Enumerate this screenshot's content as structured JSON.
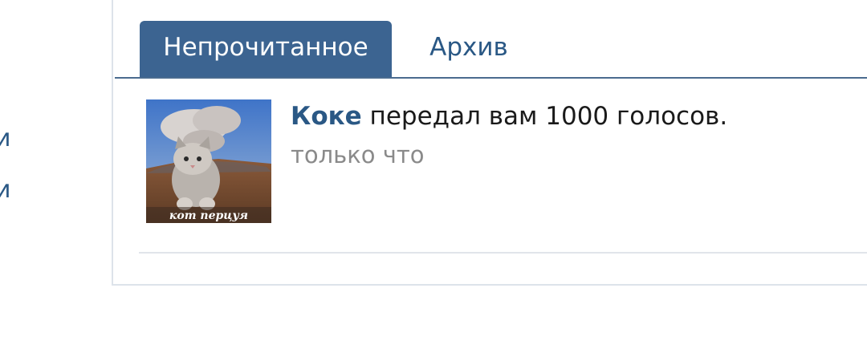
{
  "left_menu": {
    "items": [
      "и",
      "и"
    ]
  },
  "tabs": [
    {
      "label": "Непрочитанное",
      "active": true
    },
    {
      "label": "Архив",
      "active": false
    }
  ],
  "notification": {
    "user": "Коке",
    "message": " передал вам 1000 голосов.",
    "time": "только что",
    "thumbnail_caption": "кот перцуя"
  },
  "colors": {
    "accent": "#3c6491",
    "link": "#2a5885",
    "muted": "#8a8a8a",
    "divider": "#e1e5ea"
  }
}
